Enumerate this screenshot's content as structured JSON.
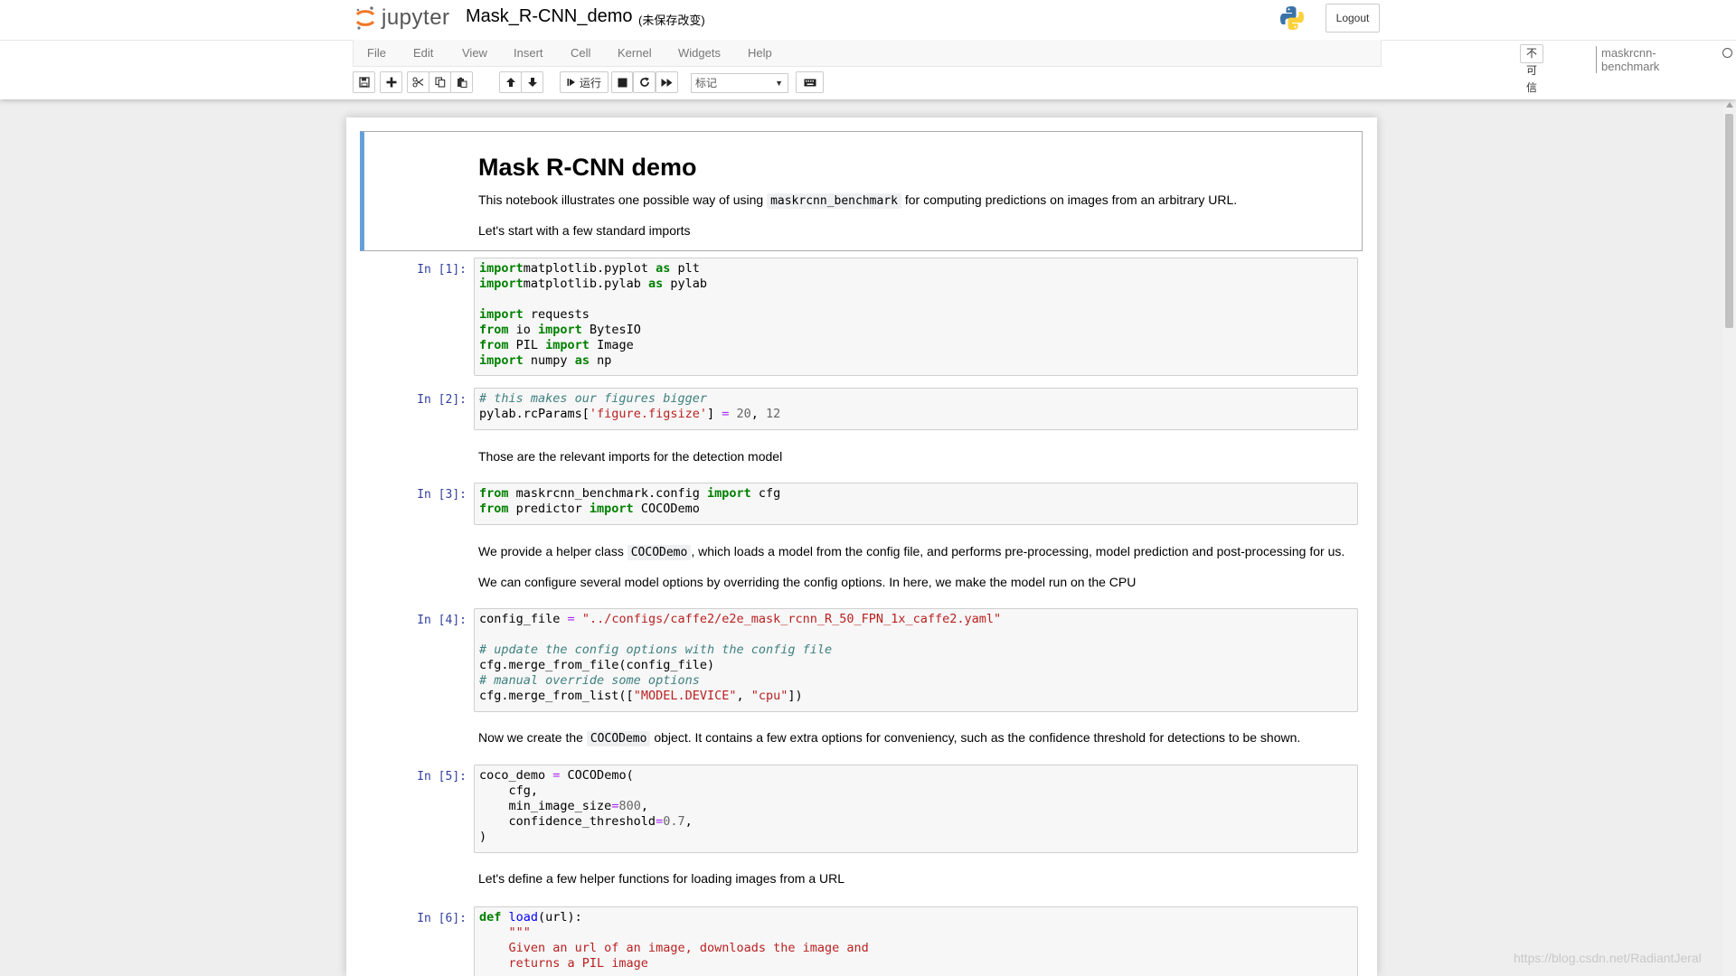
{
  "header": {
    "logo_text": "jupyter",
    "notebook_name": "Mask_R-CNN_demo",
    "autosave_status": "(未保存改变)",
    "logout_label": "Logout"
  },
  "menubar": {
    "items": [
      "File",
      "Edit",
      "View",
      "Insert",
      "Cell",
      "Kernel",
      "Widgets",
      "Help"
    ],
    "trust_label": "不可信",
    "kernel_name": "maskrcnn-benchmark"
  },
  "toolbar": {
    "run_label": "运行",
    "cell_type": "标记"
  },
  "notebook": {
    "title": "Mask R-CNN demo",
    "intro_pre": "This notebook illustrates one possible way of using ",
    "intro_code": "maskrcnn_benchmark",
    "intro_post": " for computing predictions on images from an arbitrary URL.",
    "imports_note": "Let's start with a few standard imports",
    "detection_note": "Those are the relevant imports for the detection model",
    "helper_pre": "We provide a helper class ",
    "helper_code": "COCODemo",
    "helper_post": ", which loads a model from the config file, and performs pre-processing, model prediction and post-processing for us.",
    "config_note": "We can configure several model options by overriding the config options. In here, we make the model run on the CPU",
    "create_pre": "Now we create the ",
    "create_code": "COCODemo",
    "create_post": " object. It contains a few extra options for conveniency, such as the confidence threshold for detections to be shown.",
    "define_note": "Let's define a few helper functions for loading images from a URL",
    "cells": [
      {
        "prompt": "In [1]:",
        "lines": [
          [
            [
              "kw",
              "import"
            ],
            [
              "",
              "matplotlib.pyplot "
            ],
            [
              "kw",
              "as"
            ],
            [
              "",
              " plt"
            ]
          ],
          [
            [
              "kw",
              "import"
            ],
            [
              "",
              "matplotlib.pylab "
            ],
            [
              "kw",
              "as"
            ],
            [
              "",
              " pylab"
            ]
          ],
          [],
          [
            [
              "kw",
              "import"
            ],
            [
              "",
              " requests"
            ]
          ],
          [
            [
              "kw",
              "from"
            ],
            [
              "",
              " io "
            ],
            [
              "kw",
              "import"
            ],
            [
              "",
              " BytesIO"
            ]
          ],
          [
            [
              "kw",
              "from"
            ],
            [
              "",
              " PIL "
            ],
            [
              "kw",
              "import"
            ],
            [
              "",
              " Image"
            ]
          ],
          [
            [
              "kw",
              "import"
            ],
            [
              "",
              " numpy "
            ],
            [
              "kw",
              "as"
            ],
            [
              "",
              " np"
            ]
          ]
        ]
      },
      {
        "prompt": "In [2]:",
        "lines": [
          [
            [
              "cm",
              "# this makes our figures bigger"
            ]
          ],
          [
            [
              "",
              "pylab.rcParams["
            ],
            [
              "st",
              "'figure.figsize'"
            ],
            [
              "",
              "] "
            ],
            [
              "op",
              "="
            ],
            [
              "",
              " "
            ],
            [
              "nm",
              "20"
            ],
            [
              "",
              ", "
            ],
            [
              "nm",
              "12"
            ]
          ]
        ]
      },
      {
        "prompt": "In [3]:",
        "lines": [
          [
            [
              "kw",
              "from"
            ],
            [
              "",
              " maskrcnn_benchmark.config "
            ],
            [
              "kw",
              "import"
            ],
            [
              "",
              " cfg"
            ]
          ],
          [
            [
              "kw",
              "from"
            ],
            [
              "",
              " predictor "
            ],
            [
              "kw",
              "import"
            ],
            [
              "",
              " COCODemo"
            ]
          ]
        ]
      },
      {
        "prompt": "In [4]:",
        "lines": [
          [
            [
              "",
              "config_file "
            ],
            [
              "op",
              "="
            ],
            [
              "",
              " "
            ],
            [
              "st",
              "\"../configs/caffe2/e2e_mask_rcnn_R_50_FPN_1x_caffe2.yaml\""
            ]
          ],
          [],
          [
            [
              "cm",
              "# update the config options with the config file"
            ]
          ],
          [
            [
              "",
              "cfg.merge_from_file(config_file)"
            ]
          ],
          [
            [
              "cm",
              "# manual override some options"
            ]
          ],
          [
            [
              "",
              "cfg.merge_from_list(["
            ],
            [
              "st",
              "\"MODEL.DEVICE\""
            ],
            [
              "",
              ", "
            ],
            [
              "st",
              "\"cpu\""
            ],
            [
              "",
              "])"
            ]
          ]
        ]
      },
      {
        "prompt": "In [5]:",
        "lines": [
          [
            [
              "",
              "coco_demo "
            ],
            [
              "op",
              "="
            ],
            [
              "",
              " COCODemo("
            ]
          ],
          [
            [
              "",
              "    cfg,"
            ]
          ],
          [
            [
              "",
              "    min_image_size"
            ],
            [
              "op",
              "="
            ],
            [
              "nm",
              "800"
            ],
            [
              "",
              ","
            ]
          ],
          [
            [
              "",
              "    confidence_threshold"
            ],
            [
              "op",
              "="
            ],
            [
              "nm",
              "0.7"
            ],
            [
              "",
              ","
            ]
          ],
          [
            [
              "",
              ")"
            ]
          ]
        ]
      },
      {
        "prompt": "In [6]:",
        "lines": [
          [
            [
              "kw",
              "def"
            ],
            [
              "",
              " "
            ],
            [
              "fn",
              "load"
            ],
            [
              "",
              "(url):"
            ]
          ],
          [
            [
              "",
              "    "
            ],
            [
              "st",
              "\"\"\""
            ]
          ],
          [
            [
              "st",
              "    Given an url of an image, downloads the image and"
            ]
          ],
          [
            [
              "st",
              "    returns a PIL image"
            ]
          ]
        ]
      }
    ]
  },
  "watermark": "https://blog.csdn.net/RadiantJeral"
}
